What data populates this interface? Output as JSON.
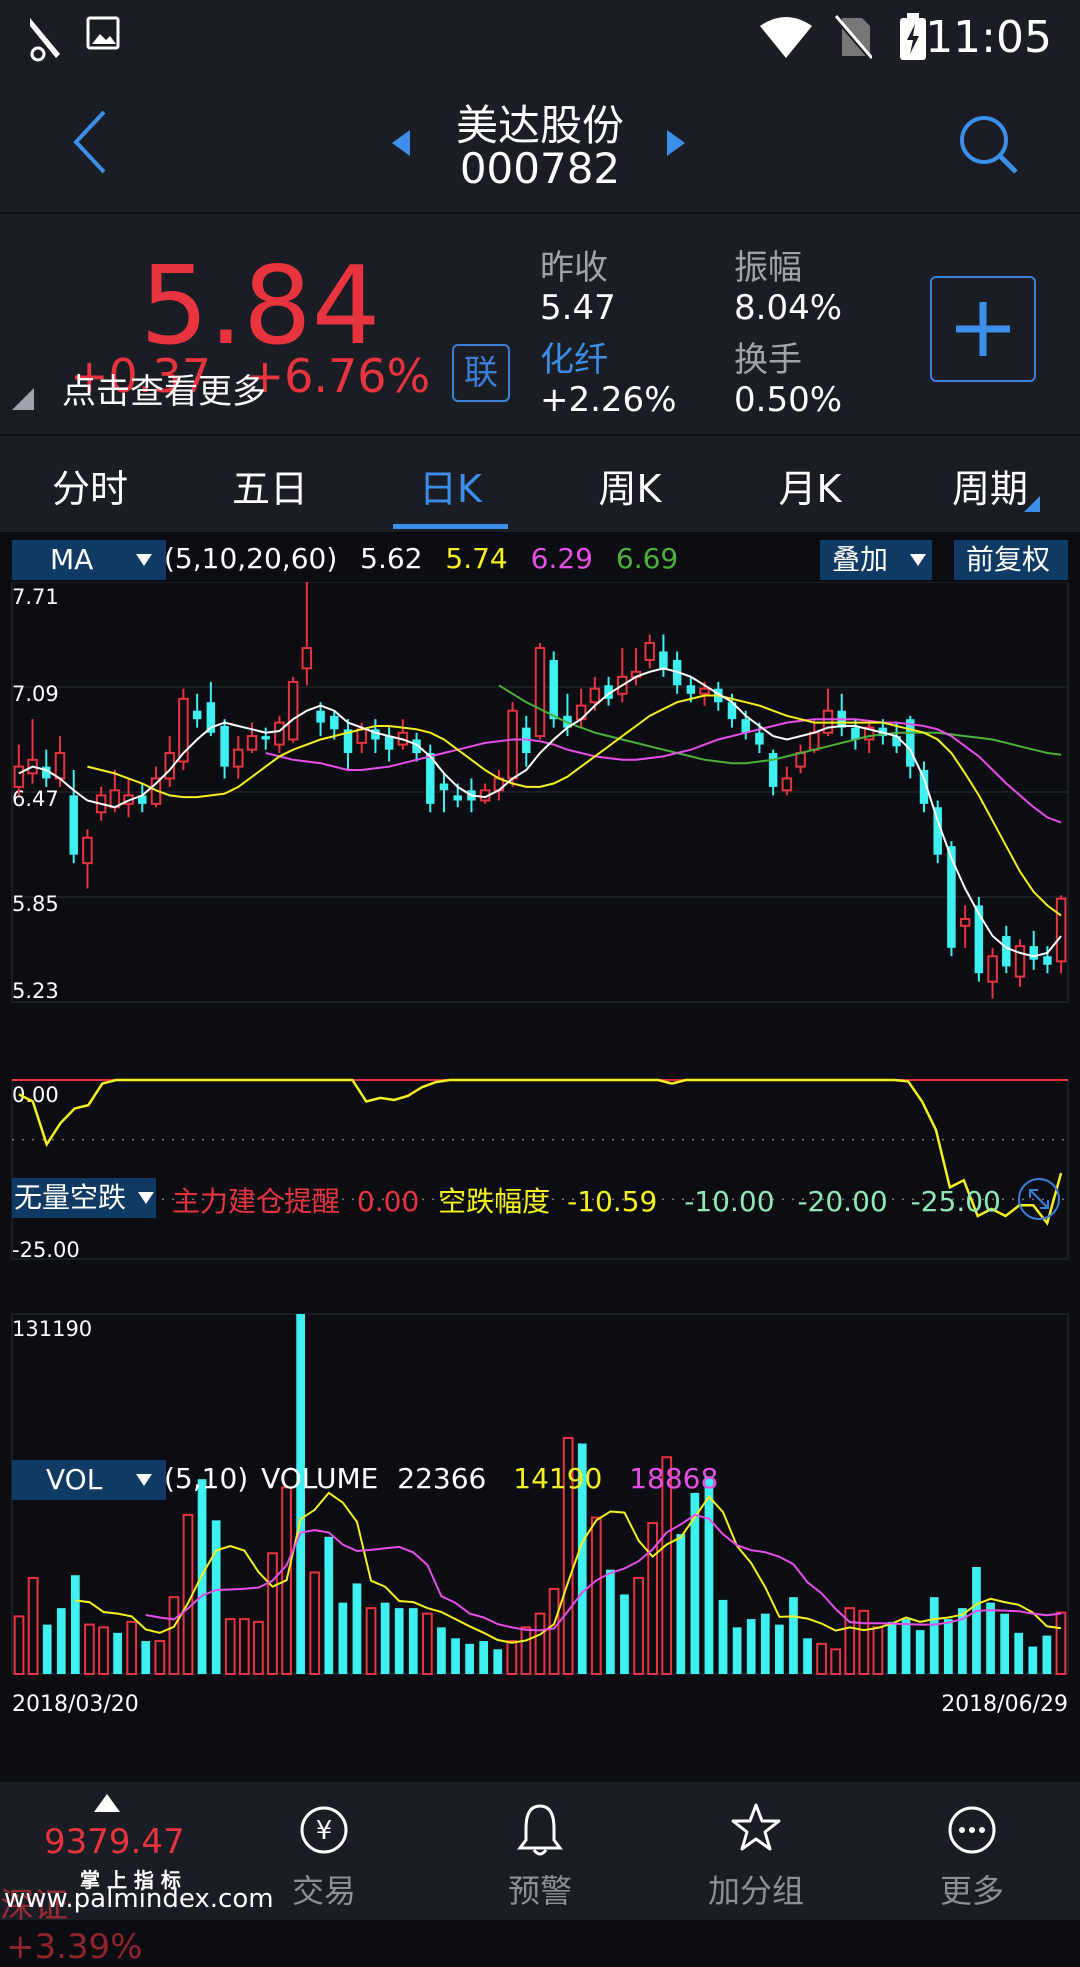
{
  "status": {
    "time": "11:05"
  },
  "header": {
    "stock_name": "美达股份",
    "stock_code": "000782"
  },
  "quote": {
    "price": "5.84",
    "change": "+0.37",
    "change_pct": "+6.76%",
    "hint": "点击查看更多",
    "lian": "联",
    "prev_close_label": "昨收",
    "prev_close": "5.47",
    "amplitude_label": "振幅",
    "amplitude": "8.04%",
    "sector_label": "化纤",
    "sector_change": "+2.26%",
    "turnover_label": "换手",
    "turnover": "0.50%"
  },
  "tabs": [
    "分时",
    "五日",
    "日K",
    "周K",
    "月K",
    "周期"
  ],
  "active_tab": "日K",
  "ma_panel": {
    "selector": "MA",
    "params": "(5,10,20,60)",
    "ma5": "5.62",
    "ma10": "5.74",
    "ma20": "6.29",
    "ma60": "6.69",
    "overlay_btn": "叠加",
    "adjust_btn": "前复权",
    "y_ticks": [
      "7.71",
      "7.09",
      "6.47",
      "5.85",
      "5.23"
    ]
  },
  "indicator_panel": {
    "selector": "无量空跌",
    "label1": "主力建仓提醒",
    "val1": "0.00",
    "label2": "空跌幅度",
    "val2": "-10.59",
    "val3": "-10.00",
    "val4": "-20.00",
    "val5": "-25.00",
    "y_top": "0.00",
    "y_bottom": "-25.00"
  },
  "vol_panel": {
    "selector": "VOL",
    "params": "(5,10)",
    "label": "VOLUME",
    "volume": "22366",
    "ma5": "14190",
    "ma10": "18868",
    "y_top": "131190",
    "date_start": "2018/03/20",
    "date_end": "2018/06/29"
  },
  "nav": {
    "index_value": "9379.47",
    "index_name": "深证",
    "index_pct": "+3.39%",
    "watermark_cn": "掌 上 指 标",
    "watermark_url": "www.palmindex.com",
    "items": [
      "交易",
      "预警",
      "加分组",
      "更多"
    ]
  },
  "colors": {
    "up": "#e7343f",
    "down": "#3ff0f0",
    "ma5": "#ffffff",
    "ma10": "#f5f21e",
    "ma20": "#e64ee6",
    "ma60": "#4caf3c",
    "accent": "#3b8fe8"
  },
  "chart_data": {
    "type": "candlestick",
    "x_range": [
      "2018/03/20",
      "2018/06/29"
    ],
    "ylim": [
      5.23,
      7.71
    ],
    "candles": [
      {
        "o": 6.5,
        "c": 6.62,
        "h": 6.75,
        "l": 6.45
      },
      {
        "o": 6.58,
        "c": 6.66,
        "h": 6.9,
        "l": 6.52
      },
      {
        "o": 6.62,
        "c": 6.55,
        "h": 6.72,
        "l": 6.5
      },
      {
        "o": 6.55,
        "c": 6.7,
        "h": 6.8,
        "l": 6.5
      },
      {
        "o": 6.45,
        "c": 6.1,
        "h": 6.6,
        "l": 6.05
      },
      {
        "o": 6.05,
        "c": 6.2,
        "h": 6.25,
        "l": 5.9
      },
      {
        "o": 6.35,
        "c": 6.45,
        "h": 6.5,
        "l": 6.3
      },
      {
        "o": 6.38,
        "c": 6.48,
        "h": 6.6,
        "l": 6.35
      },
      {
        "o": 6.4,
        "c": 6.45,
        "h": 6.55,
        "l": 6.32
      },
      {
        "o": 6.45,
        "c": 6.4,
        "h": 6.52,
        "l": 6.35
      },
      {
        "o": 6.4,
        "c": 6.55,
        "h": 6.62,
        "l": 6.38
      },
      {
        "o": 6.55,
        "c": 6.7,
        "h": 6.8,
        "l": 6.5
      },
      {
        "o": 6.65,
        "c": 7.02,
        "h": 7.08,
        "l": 6.6
      },
      {
        "o": 6.95,
        "c": 6.9,
        "h": 7.05,
        "l": 6.85
      },
      {
        "o": 7.0,
        "c": 6.82,
        "h": 7.12,
        "l": 6.8
      },
      {
        "o": 6.86,
        "c": 6.62,
        "h": 6.9,
        "l": 6.55
      },
      {
        "o": 6.62,
        "c": 6.72,
        "h": 6.8,
        "l": 6.55
      },
      {
        "o": 6.72,
        "c": 6.8,
        "h": 6.88,
        "l": 6.7
      },
      {
        "o": 6.8,
        "c": 6.78,
        "h": 6.85,
        "l": 6.72
      },
      {
        "o": 6.75,
        "c": 6.88,
        "h": 6.92,
        "l": 6.7
      },
      {
        "o": 6.78,
        "c": 7.12,
        "h": 7.15,
        "l": 6.76
      },
      {
        "o": 7.2,
        "c": 7.32,
        "h": 7.71,
        "l": 7.1
      },
      {
        "o": 6.95,
        "c": 6.88,
        "h": 7.0,
        "l": 6.8
      },
      {
        "o": 6.92,
        "c": 6.84,
        "h": 6.95,
        "l": 6.78
      },
      {
        "o": 6.84,
        "c": 6.7,
        "h": 6.9,
        "l": 6.6
      },
      {
        "o": 6.76,
        "c": 6.84,
        "h": 6.88,
        "l": 6.7
      },
      {
        "o": 6.84,
        "c": 6.78,
        "h": 6.9,
        "l": 6.7
      },
      {
        "o": 6.8,
        "c": 6.72,
        "h": 6.86,
        "l": 6.65
      },
      {
        "o": 6.75,
        "c": 6.82,
        "h": 6.9,
        "l": 6.72
      },
      {
        "o": 6.78,
        "c": 6.7,
        "h": 6.82,
        "l": 6.65
      },
      {
        "o": 6.7,
        "c": 6.4,
        "h": 6.75,
        "l": 6.35
      },
      {
        "o": 6.52,
        "c": 6.48,
        "h": 6.58,
        "l": 6.35
      },
      {
        "o": 6.45,
        "c": 6.42,
        "h": 6.52,
        "l": 6.38
      },
      {
        "o": 6.48,
        "c": 6.42,
        "h": 6.55,
        "l": 6.35
      },
      {
        "o": 6.42,
        "c": 6.48,
        "h": 6.52,
        "l": 6.4
      },
      {
        "o": 6.48,
        "c": 6.55,
        "h": 6.6,
        "l": 6.42
      },
      {
        "o": 6.55,
        "c": 6.95,
        "h": 7.0,
        "l": 6.5
      },
      {
        "o": 6.85,
        "c": 6.7,
        "h": 6.92,
        "l": 6.62
      },
      {
        "o": 6.8,
        "c": 7.32,
        "h": 7.35,
        "l": 6.78
      },
      {
        "o": 7.25,
        "c": 6.9,
        "h": 7.3,
        "l": 6.85
      },
      {
        "o": 6.92,
        "c": 6.85,
        "h": 7.05,
        "l": 6.8
      },
      {
        "o": 6.9,
        "c": 6.98,
        "h": 7.08,
        "l": 6.85
      },
      {
        "o": 7.0,
        "c": 7.08,
        "h": 7.15,
        "l": 6.95
      },
      {
        "o": 7.1,
        "c": 7.02,
        "h": 7.15,
        "l": 6.98
      },
      {
        "o": 7.05,
        "c": 7.15,
        "h": 7.32,
        "l": 7.0
      },
      {
        "o": 7.15,
        "c": 7.18,
        "h": 7.32,
        "l": 7.1
      },
      {
        "o": 7.25,
        "c": 7.35,
        "h": 7.4,
        "l": 7.2
      },
      {
        "o": 7.3,
        "c": 7.2,
        "h": 7.4,
        "l": 7.15
      },
      {
        "o": 7.25,
        "c": 7.1,
        "h": 7.3,
        "l": 7.05
      },
      {
        "o": 7.1,
        "c": 7.05,
        "h": 7.15,
        "l": 7.0
      },
      {
        "o": 7.05,
        "c": 7.08,
        "h": 7.12,
        "l": 6.98
      },
      {
        "o": 7.08,
        "c": 7.0,
        "h": 7.12,
        "l": 6.95
      },
      {
        "o": 7.0,
        "c": 6.9,
        "h": 7.05,
        "l": 6.85
      },
      {
        "o": 6.9,
        "c": 6.82,
        "h": 6.95,
        "l": 6.78
      },
      {
        "o": 6.82,
        "c": 6.75,
        "h": 6.88,
        "l": 6.7
      },
      {
        "o": 6.7,
        "c": 6.5,
        "h": 6.72,
        "l": 6.45
      },
      {
        "o": 6.48,
        "c": 6.55,
        "h": 6.62,
        "l": 6.45
      },
      {
        "o": 6.62,
        "c": 6.7,
        "h": 6.75,
        "l": 6.58
      },
      {
        "o": 6.72,
        "c": 6.82,
        "h": 6.9,
        "l": 6.7
      },
      {
        "o": 6.82,
        "c": 6.95,
        "h": 7.08,
        "l": 6.8
      },
      {
        "o": 6.95,
        "c": 6.85,
        "h": 7.05,
        "l": 6.8
      },
      {
        "o": 6.85,
        "c": 6.78,
        "h": 6.9,
        "l": 6.72
      },
      {
        "o": 6.78,
        "c": 6.85,
        "h": 6.88,
        "l": 6.7
      },
      {
        "o": 6.85,
        "c": 6.8,
        "h": 6.9,
        "l": 6.75
      },
      {
        "o": 6.8,
        "c": 6.74,
        "h": 6.88,
        "l": 6.7
      },
      {
        "o": 6.9,
        "c": 6.62,
        "h": 6.92,
        "l": 6.55
      },
      {
        "o": 6.6,
        "c": 6.4,
        "h": 6.65,
        "l": 6.35
      },
      {
        "o": 6.38,
        "c": 6.1,
        "h": 6.42,
        "l": 6.05
      },
      {
        "o": 6.15,
        "c": 5.55,
        "h": 6.18,
        "l": 5.5
      },
      {
        "o": 5.68,
        "c": 5.72,
        "h": 5.8,
        "l": 5.55
      },
      {
        "o": 5.8,
        "c": 5.4,
        "h": 5.85,
        "l": 5.35
      },
      {
        "o": 5.35,
        "c": 5.5,
        "h": 5.55,
        "l": 5.25
      },
      {
        "o": 5.62,
        "c": 5.44,
        "h": 5.68,
        "l": 5.4
      },
      {
        "o": 5.38,
        "c": 5.56,
        "h": 5.6,
        "l": 5.32
      },
      {
        "o": 5.56,
        "c": 5.48,
        "h": 5.65,
        "l": 5.42
      },
      {
        "o": 5.5,
        "c": 5.45,
        "h": 5.56,
        "l": 5.4
      },
      {
        "o": 5.47,
        "c": 5.84,
        "h": 5.86,
        "l": 5.4
      }
    ],
    "ma5": [
      6.58,
      6.62,
      6.6,
      6.55,
      6.48,
      6.42,
      6.4,
      6.38,
      6.42,
      6.45,
      6.52,
      6.6,
      6.7,
      6.78,
      6.85,
      6.88,
      6.86,
      6.84,
      6.82,
      6.83,
      6.9,
      6.95,
      6.98,
      6.95,
      6.88,
      6.85,
      6.82,
      6.8,
      6.78,
      6.75,
      6.68,
      6.58,
      6.5,
      6.45,
      6.44,
      6.48,
      6.55,
      6.6,
      6.7,
      6.78,
      6.85,
      6.9,
      6.98,
      7.05,
      7.1,
      7.15,
      7.18,
      7.2,
      7.18,
      7.15,
      7.1,
      7.05,
      7.0,
      6.92,
      6.86,
      6.8,
      6.78,
      6.8,
      6.82,
      6.85,
      6.86,
      6.86,
      6.84,
      6.82,
      6.8,
      6.72,
      6.55,
      6.3,
      6.08,
      5.9,
      5.75,
      5.62,
      5.55,
      5.52,
      5.5,
      5.52,
      5.62
    ],
    "ma10": [
      6.62,
      6.6,
      6.58,
      6.55,
      6.52,
      6.48,
      6.45,
      6.44,
      6.44,
      6.45,
      6.46,
      6.5,
      6.56,
      6.62,
      6.68,
      6.72,
      6.75,
      6.78,
      6.8,
      6.82,
      6.84,
      6.86,
      6.86,
      6.85,
      6.84,
      6.82,
      6.78,
      6.72,
      6.66,
      6.6,
      6.55,
      6.52,
      6.5,
      6.5,
      6.52,
      6.56,
      6.62,
      6.68,
      6.74,
      6.8,
      6.86,
      6.92,
      6.96,
      7.0,
      7.02,
      7.04,
      7.04,
      7.02,
      7.0,
      6.98,
      6.95,
      6.92,
      6.9,
      6.88,
      6.88,
      6.88,
      6.88,
      6.88,
      6.88,
      6.86,
      6.84,
      6.82,
      6.78,
      6.7,
      6.58,
      6.45,
      6.3,
      6.15,
      6.0,
      5.88,
      5.8,
      5.74
    ],
    "ma20": [
      6.7,
      6.68,
      6.66,
      6.65,
      6.64,
      6.62,
      6.6,
      6.6,
      6.61,
      6.62,
      6.64,
      6.66,
      6.68,
      6.7,
      6.72,
      6.74,
      6.76,
      6.77,
      6.78,
      6.78,
      6.77,
      6.75,
      6.72,
      6.7,
      6.68,
      6.67,
      6.66,
      6.66,
      6.67,
      6.68,
      6.7,
      6.72,
      6.75,
      6.78,
      6.8,
      6.82,
      6.84,
      6.86,
      6.88,
      6.89,
      6.9,
      6.9,
      6.9,
      6.9,
      6.89,
      6.88,
      6.88,
      6.87,
      6.86,
      6.84,
      6.8,
      6.74,
      6.68,
      6.6,
      6.52,
      6.45,
      6.38,
      6.32,
      6.29
    ],
    "ma60": [
      7.1,
      7.05,
      7.0,
      6.96,
      6.92,
      6.88,
      6.85,
      6.82,
      6.8,
      6.78,
      6.76,
      6.74,
      6.72,
      6.7,
      6.68,
      6.66,
      6.65,
      6.64,
      6.64,
      6.65,
      6.66,
      6.68,
      6.7,
      6.72,
      6.74,
      6.76,
      6.78,
      6.8,
      6.81,
      6.82,
      6.82,
      6.82,
      6.82,
      6.81,
      6.8,
      6.79,
      6.78,
      6.76,
      6.74,
      6.72,
      6.7,
      6.69
    ],
    "indicator": {
      "ylim": [
        -25,
        0
      ],
      "line": [
        -2,
        -3,
        -9,
        -6,
        -4,
        -3.5,
        -0.5,
        0,
        0,
        0,
        0,
        0,
        0,
        0,
        0,
        0,
        0,
        0,
        0,
        0,
        0,
        0,
        0,
        0,
        0,
        -3,
        -2.5,
        -2.8,
        -2.2,
        -1,
        -0.3,
        0,
        0,
        0,
        0,
        0,
        0,
        0,
        0,
        0,
        0,
        0,
        0,
        0,
        0,
        0,
        0,
        -0.5,
        0,
        0,
        0,
        0,
        0,
        0,
        0,
        0,
        0,
        0,
        0,
        0,
        0,
        0,
        0,
        0,
        -0.2,
        -3,
        -7,
        -15,
        -14,
        -19,
        -18,
        -19,
        -17.5,
        -17.5,
        -20,
        -13
      ]
    },
    "volume": {
      "ylim": [
        0,
        131190
      ],
      "bars": [
        {
          "v": 21000,
          "up": true
        },
        {
          "v": 35000,
          "up": true
        },
        {
          "v": 18000,
          "up": false
        },
        {
          "v": 24000,
          "up": false
        },
        {
          "v": 36000,
          "up": false
        },
        {
          "v": 18000,
          "up": true
        },
        {
          "v": 17000,
          "up": true
        },
        {
          "v": 15000,
          "up": false
        },
        {
          "v": 19000,
          "up": true
        },
        {
          "v": 12000,
          "up": false
        },
        {
          "v": 12000,
          "up": true
        },
        {
          "v": 28000,
          "up": true
        },
        {
          "v": 58000,
          "up": true
        },
        {
          "v": 71000,
          "up": false
        },
        {
          "v": 56000,
          "up": false
        },
        {
          "v": 20000,
          "up": true
        },
        {
          "v": 20000,
          "up": true
        },
        {
          "v": 19000,
          "up": true
        },
        {
          "v": 44000,
          "up": true
        },
        {
          "v": 68000,
          "up": true
        },
        {
          "v": 131190,
          "up": false
        },
        {
          "v": 37000,
          "up": true
        },
        {
          "v": 50000,
          "up": false
        },
        {
          "v": 26000,
          "up": false
        },
        {
          "v": 33000,
          "up": false
        },
        {
          "v": 24000,
          "up": true
        },
        {
          "v": 26000,
          "up": false
        },
        {
          "v": 24000,
          "up": false
        },
        {
          "v": 24000,
          "up": false
        },
        {
          "v": 22000,
          "up": true
        },
        {
          "v": 17000,
          "up": false
        },
        {
          "v": 13000,
          "up": false
        },
        {
          "v": 11000,
          "up": false
        },
        {
          "v": 12000,
          "up": false
        },
        {
          "v": 9000,
          "up": false
        },
        {
          "v": 12000,
          "up": true
        },
        {
          "v": 17000,
          "up": true
        },
        {
          "v": 22000,
          "up": true
        },
        {
          "v": 31000,
          "up": true
        },
        {
          "v": 86000,
          "up": true
        },
        {
          "v": 84000,
          "up": false
        },
        {
          "v": 57000,
          "up": true
        },
        {
          "v": 38000,
          "up": false
        },
        {
          "v": 29000,
          "up": false
        },
        {
          "v": 35000,
          "up": true
        },
        {
          "v": 55000,
          "up": true
        },
        {
          "v": 79000,
          "up": true
        },
        {
          "v": 51000,
          "up": false
        },
        {
          "v": 66000,
          "up": false
        },
        {
          "v": 72000,
          "up": false
        },
        {
          "v": 27000,
          "up": false
        },
        {
          "v": 17000,
          "up": false
        },
        {
          "v": 20000,
          "up": false
        },
        {
          "v": 22000,
          "up": false
        },
        {
          "v": 18000,
          "up": false
        },
        {
          "v": 28000,
          "up": false
        },
        {
          "v": 13000,
          "up": false
        },
        {
          "v": 11000,
          "up": true
        },
        {
          "v": 9000,
          "up": true
        },
        {
          "v": 24000,
          "up": true
        },
        {
          "v": 23000,
          "up": true
        },
        {
          "v": 17000,
          "up": true
        },
        {
          "v": 19000,
          "up": false
        },
        {
          "v": 20000,
          "up": false
        },
        {
          "v": 16000,
          "up": false
        },
        {
          "v": 28000,
          "up": false
        },
        {
          "v": 20000,
          "up": false
        },
        {
          "v": 24000,
          "up": false
        },
        {
          "v": 39000,
          "up": false
        },
        {
          "v": 26000,
          "up": false
        },
        {
          "v": 22000,
          "up": false
        },
        {
          "v": 15000,
          "up": false
        },
        {
          "v": 10000,
          "up": false
        },
        {
          "v": 14000,
          "up": false
        },
        {
          "v": 22366,
          "up": true
        }
      ]
    }
  }
}
